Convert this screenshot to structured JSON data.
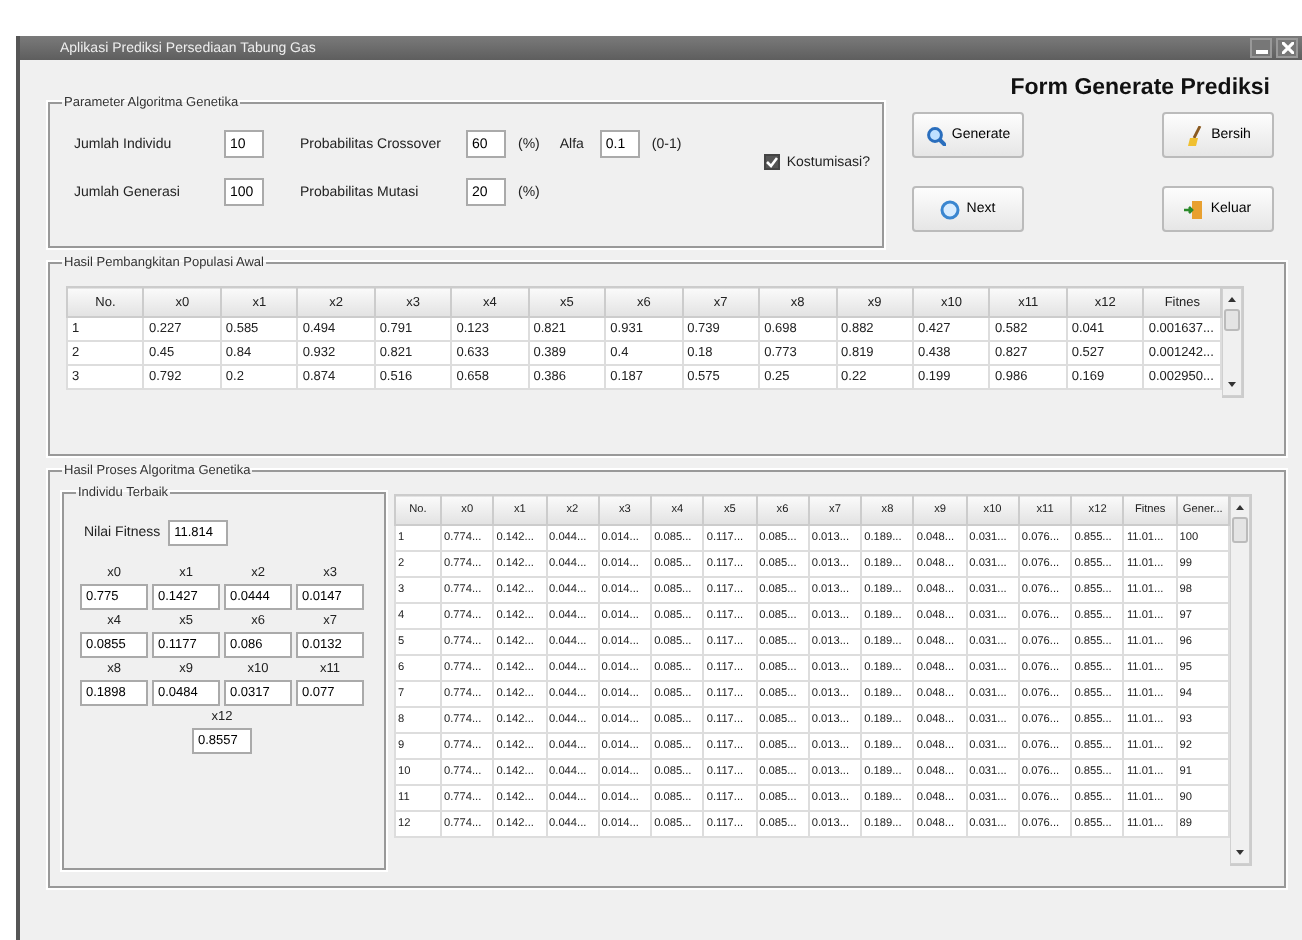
{
  "window": {
    "title": "Aplikasi Prediksi Persediaan Tabung Gas"
  },
  "parameters": {
    "title": "Parameter Algoritma Genetika",
    "rows": [
      [
        {
          "label": "Jumlah Individu",
          "value": "10"
        },
        {
          "label": "Probabilitas Crossover",
          "value": "60",
          "unit": "(%)"
        },
        {
          "label": "Alfa",
          "value": "0.1",
          "unit": "(0-1)"
        }
      ],
      [
        {
          "label": "Jumlah Generasi",
          "value": "100"
        },
        {
          "label": "Probabilitas Mutasi",
          "value": "20",
          "unit": "(%)"
        }
      ]
    ],
    "customize": {
      "label": "Kostumisasi?",
      "checked": true
    }
  },
  "form_title": "Form Generate Prediksi",
  "buttons": [
    {
      "label": "Generate",
      "kind": "search"
    },
    {
      "label": "Bersih",
      "kind": "broom"
    },
    {
      "label": "Next",
      "kind": "next"
    },
    {
      "label": "Keluar",
      "kind": "exit"
    }
  ],
  "initial_population": {
    "title": "Hasil Pembangkitan Populasi Awal",
    "columns": [
      "No.",
      "x0",
      "x1",
      "x2",
      "x3",
      "x4",
      "x5",
      "x6",
      "x7",
      "x8",
      "x9",
      "x10",
      "x11",
      "x12",
      "Fitnes"
    ],
    "rows": [
      [
        "1",
        "0.227",
        "0.585",
        "0.494",
        "0.791",
        "0.123",
        "0.821",
        "0.931",
        "0.739",
        "0.698",
        "0.882",
        "0.427",
        "0.582",
        "0.041",
        "0.001637..."
      ],
      [
        "2",
        "0.45",
        "0.84",
        "0.932",
        "0.821",
        "0.633",
        "0.389",
        "0.4",
        "0.18",
        "0.773",
        "0.819",
        "0.438",
        "0.827",
        "0.527",
        "0.001242..."
      ],
      [
        "3",
        "0.792",
        "0.2",
        "0.874",
        "0.516",
        "0.658",
        "0.386",
        "0.187",
        "0.575",
        "0.25",
        "0.22",
        "0.199",
        "0.986",
        "0.169",
        "0.002950..."
      ]
    ]
  },
  "process": {
    "title": "Hasil Proses Algoritma Genetika",
    "best": {
      "title": "Individu Terbaik",
      "fitness_label": "Nilai Fitness",
      "fitness": "11.814",
      "genes": [
        {
          "label": "x0",
          "value": "0.775"
        },
        {
          "label": "x1",
          "value": "0.1427"
        },
        {
          "label": "x2",
          "value": "0.0444"
        },
        {
          "label": "x3",
          "value": "0.0147"
        },
        {
          "label": "x4",
          "value": "0.0855"
        },
        {
          "label": "x5",
          "value": "0.1177"
        },
        {
          "label": "x6",
          "value": "0.086"
        },
        {
          "label": "x7",
          "value": "0.0132"
        },
        {
          "label": "x8",
          "value": "0.1898"
        },
        {
          "label": "x9",
          "value": "0.0484"
        },
        {
          "label": "x10",
          "value": "0.0317"
        },
        {
          "label": "x11",
          "value": "0.077"
        },
        {
          "label": "x12",
          "value": "0.8557"
        }
      ]
    },
    "columns": [
      "No.",
      "x0",
      "x1",
      "x2",
      "x3",
      "x4",
      "x5",
      "x6",
      "x7",
      "x8",
      "x9",
      "x10",
      "x11",
      "x12",
      "Fitnes",
      "Gener..."
    ],
    "rows": [
      [
        "1",
        "0.774...",
        "0.142...",
        "0.044...",
        "0.014...",
        "0.085...",
        "0.117...",
        "0.085...",
        "0.013...",
        "0.189...",
        "0.048...",
        "0.031...",
        "0.076...",
        "0.855...",
        "11.01...",
        "100"
      ],
      [
        "2",
        "0.774...",
        "0.142...",
        "0.044...",
        "0.014...",
        "0.085...",
        "0.117...",
        "0.085...",
        "0.013...",
        "0.189...",
        "0.048...",
        "0.031...",
        "0.076...",
        "0.855...",
        "11.01...",
        "99"
      ],
      [
        "3",
        "0.774...",
        "0.142...",
        "0.044...",
        "0.014...",
        "0.085...",
        "0.117...",
        "0.085...",
        "0.013...",
        "0.189...",
        "0.048...",
        "0.031...",
        "0.076...",
        "0.855...",
        "11.01...",
        "98"
      ],
      [
        "4",
        "0.774...",
        "0.142...",
        "0.044...",
        "0.014...",
        "0.085...",
        "0.117...",
        "0.085...",
        "0.013...",
        "0.189...",
        "0.048...",
        "0.031...",
        "0.076...",
        "0.855...",
        "11.01...",
        "97"
      ],
      [
        "5",
        "0.774...",
        "0.142...",
        "0.044...",
        "0.014...",
        "0.085...",
        "0.117...",
        "0.085...",
        "0.013...",
        "0.189...",
        "0.048...",
        "0.031...",
        "0.076...",
        "0.855...",
        "11.01...",
        "96"
      ],
      [
        "6",
        "0.774...",
        "0.142...",
        "0.044...",
        "0.014...",
        "0.085...",
        "0.117...",
        "0.085...",
        "0.013...",
        "0.189...",
        "0.048...",
        "0.031...",
        "0.076...",
        "0.855...",
        "11.01...",
        "95"
      ],
      [
        "7",
        "0.774...",
        "0.142...",
        "0.044...",
        "0.014...",
        "0.085...",
        "0.117...",
        "0.085...",
        "0.013...",
        "0.189...",
        "0.048...",
        "0.031...",
        "0.076...",
        "0.855...",
        "11.01...",
        "94"
      ],
      [
        "8",
        "0.774...",
        "0.142...",
        "0.044...",
        "0.014...",
        "0.085...",
        "0.117...",
        "0.085...",
        "0.013...",
        "0.189...",
        "0.048...",
        "0.031...",
        "0.076...",
        "0.855...",
        "11.01...",
        "93"
      ],
      [
        "9",
        "0.774...",
        "0.142...",
        "0.044...",
        "0.014...",
        "0.085...",
        "0.117...",
        "0.085...",
        "0.013...",
        "0.189...",
        "0.048...",
        "0.031...",
        "0.076...",
        "0.855...",
        "11.01...",
        "92"
      ],
      [
        "10",
        "0.774...",
        "0.142...",
        "0.044...",
        "0.014...",
        "0.085...",
        "0.117...",
        "0.085...",
        "0.013...",
        "0.189...",
        "0.048...",
        "0.031...",
        "0.076...",
        "0.855...",
        "11.01...",
        "91"
      ],
      [
        "11",
        "0.774...",
        "0.142...",
        "0.044...",
        "0.014...",
        "0.085...",
        "0.117...",
        "0.085...",
        "0.013...",
        "0.189...",
        "0.048...",
        "0.031...",
        "0.076...",
        "0.855...",
        "11.01...",
        "90"
      ],
      [
        "12",
        "0.774...",
        "0.142...",
        "0.044...",
        "0.014...",
        "0.085...",
        "0.117...",
        "0.085...",
        "0.013...",
        "0.189...",
        "0.048...",
        "0.031...",
        "0.076...",
        "0.855...",
        "11.01...",
        "89"
      ]
    ]
  }
}
